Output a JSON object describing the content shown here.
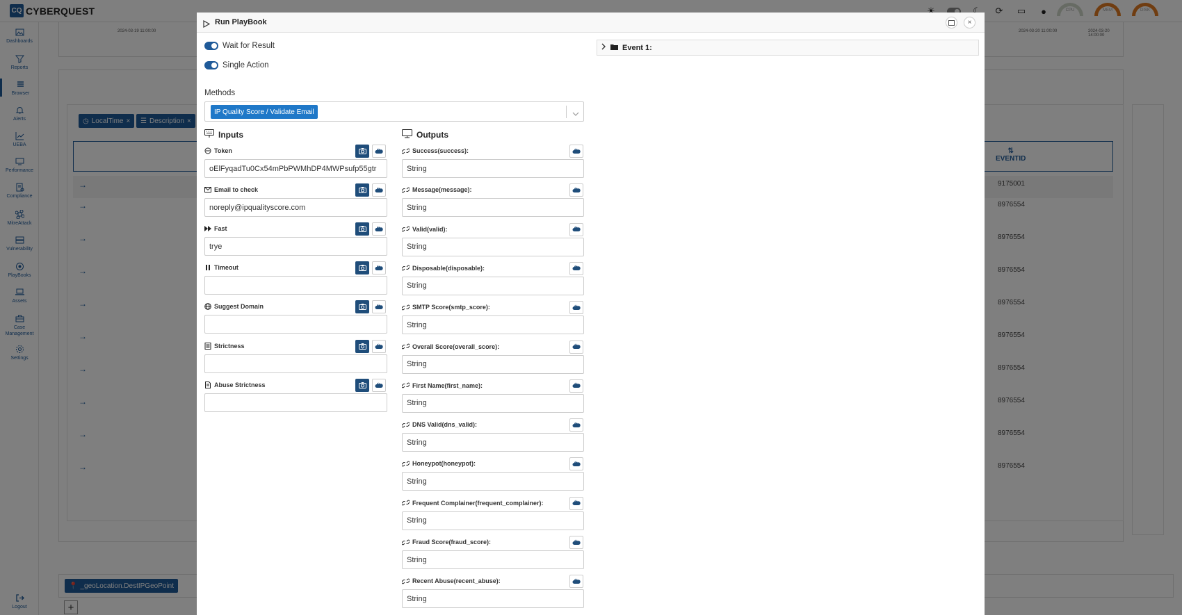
{
  "app": {
    "logo_mark": "CQ",
    "logo_text": "CYBERQUEST",
    "gauges": [
      {
        "label": "CPU",
        "color": "#cfd6c8"
      },
      {
        "label": "MEM",
        "color": "#e07b22"
      },
      {
        "label": "DISK",
        "color": "#e07b22"
      }
    ]
  },
  "sidebar": {
    "items": [
      {
        "label": "Dashboards",
        "icon": "image-icon"
      },
      {
        "label": "Reports",
        "icon": "filter-icon"
      },
      {
        "label": "Browser",
        "icon": "list-icon"
      },
      {
        "label": "Alerts",
        "icon": "bell-icon"
      },
      {
        "label": "UEBA",
        "icon": "chart-line-icon"
      },
      {
        "label": "Performance",
        "icon": "monitor-icon"
      },
      {
        "label": "Compliance",
        "icon": "compliance-icon"
      },
      {
        "label": "MitreAttack",
        "icon": "command-icon"
      },
      {
        "label": "Vulnerability",
        "icon": "vulnerability-icon"
      },
      {
        "label": "PlayBooks",
        "icon": "playbook-icon"
      },
      {
        "label": "Assets",
        "icon": "laptop-icon"
      },
      {
        "label": "Case Management",
        "icon": "briefcase-icon"
      },
      {
        "label": "Settings",
        "icon": "gear-icon"
      }
    ],
    "logout": "Logout"
  },
  "background": {
    "ticks": [
      "2024-03-19 11:00:00",
      "2024-03-20 11:00:00",
      "2024-03-20 14:00:00"
    ],
    "chips": [
      "LocalTime",
      "Description"
    ],
    "eventid_header": "EVENTID",
    "rows": [
      "9175001",
      "8976554",
      "8976554",
      "8976554",
      "8976554",
      "8976554",
      "8976554",
      "8976554",
      "8976554",
      "8976554"
    ],
    "geo_chip": "_geoLocation.DestIPGeoPoint"
  },
  "modal": {
    "title": "Run PlayBook",
    "wait_for_result": "Wait for Result",
    "single_action": "Single Action",
    "methods_label": "Methods",
    "method_selected": "IP Quality Score / Validate Email",
    "inputs_title": "Inputs",
    "outputs_title": "Outputs",
    "event_label": "Event 1:",
    "inputs": [
      {
        "label": "Token",
        "value": "oElFyqadTu0Cx54mPbPWMhDP4MWPsufp55gtr",
        "icon": "token-icon"
      },
      {
        "label": "Email to check",
        "value": "noreply@ipqualityscore.com",
        "icon": "envelope-icon"
      },
      {
        "label": "Fast",
        "value": "trye",
        "icon": "fast-forward-icon"
      },
      {
        "label": "Timeout",
        "value": "",
        "icon": "pause-icon"
      },
      {
        "label": "Suggest Domain",
        "value": "",
        "icon": "globe-icon"
      },
      {
        "label": "Strictness",
        "value": "",
        "icon": "list-box-icon"
      },
      {
        "label": "Abuse Strictness",
        "value": "",
        "icon": "document-icon"
      }
    ],
    "outputs": [
      {
        "label": "Success(success):",
        "value": "String"
      },
      {
        "label": "Message(message):",
        "value": "String"
      },
      {
        "label": "Valid(valid):",
        "value": "String"
      },
      {
        "label": "Disposable(disposable):",
        "value": "String"
      },
      {
        "label": "SMTP Score(smtp_score):",
        "value": "String"
      },
      {
        "label": "Overall Score(overall_score):",
        "value": "String"
      },
      {
        "label": "First Name(first_name):",
        "value": "String"
      },
      {
        "label": "DNS Valid(dns_valid):",
        "value": "String"
      },
      {
        "label": "Honeypot(honeypot):",
        "value": "String"
      },
      {
        "label": "Frequent Complainer(frequent_complainer):",
        "value": "String"
      },
      {
        "label": "Fraud Score(fraud_score):",
        "value": "String"
      },
      {
        "label": "Recent Abuse(recent_abuse):",
        "value": "String"
      }
    ]
  }
}
